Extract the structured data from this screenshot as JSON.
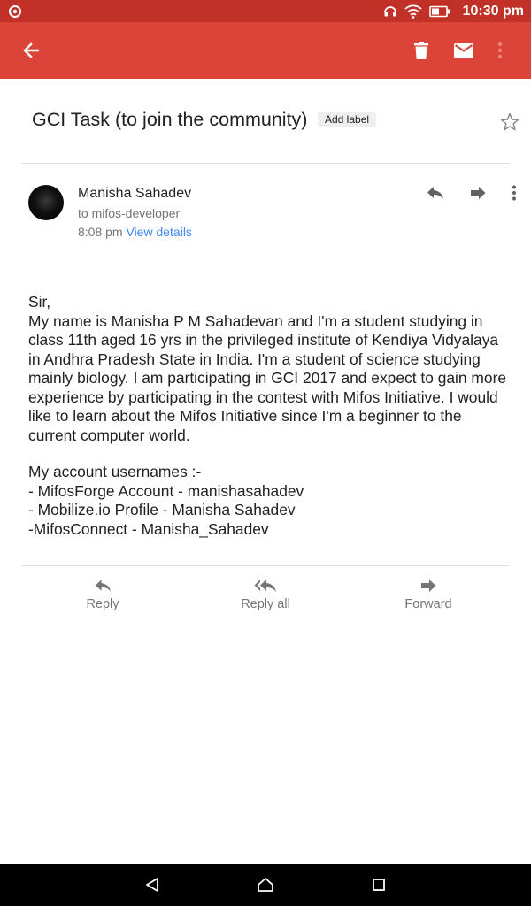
{
  "status_bar": {
    "time": "10:30 pm",
    "icons": [
      "app-notification-icon",
      "headset-icon",
      "wifi-icon",
      "battery-icon"
    ]
  },
  "app_bar": {
    "background": "#db4437",
    "icons": [
      "back-arrow-icon",
      "delete-icon",
      "mark-unread-icon",
      "overflow-menu-icon"
    ]
  },
  "message": {
    "subject": "GCI Task (to join the community)",
    "add_label": "Add label",
    "sender": {
      "name": "Manisha Sahadev",
      "recipient": "to mifos-developer",
      "time": "8:08 pm",
      "view_details": "View details"
    },
    "body": {
      "greeting": "Sir,",
      "paragraph": " My name is Manisha P M Sahadevan and I'm a student studying in class 11th aged 16 yrs in the privileged institute of Kendiya Vidyalaya in Andhra Pradesh State in India. I'm a student of science studying mainly biology. I am participating in GCI 2017 and expect to gain more experience by participating in the contest with Mifos Initiative. I would like to learn about the Mifos Initiative since I'm a beginner to the current computer world.",
      "accounts_heading": "My account usernames :-",
      "accounts": [
        "- MifosForge Account - manishasahadev",
        "- Mobilize.io Profile - Manisha Sahadev",
        "-MifosConnect - Manisha_Sahadev"
      ]
    }
  },
  "footer_actions": {
    "reply": "Reply",
    "reply_all": "Reply all",
    "forward": "Forward"
  },
  "nav_bar": {
    "icons": [
      "back-triangle-icon",
      "home-icon",
      "recents-square-icon"
    ]
  },
  "colors": {
    "status_bar": "#c13127",
    "app_bar": "#db4437",
    "link": "#4285f4",
    "secondary_text": "#757575"
  }
}
